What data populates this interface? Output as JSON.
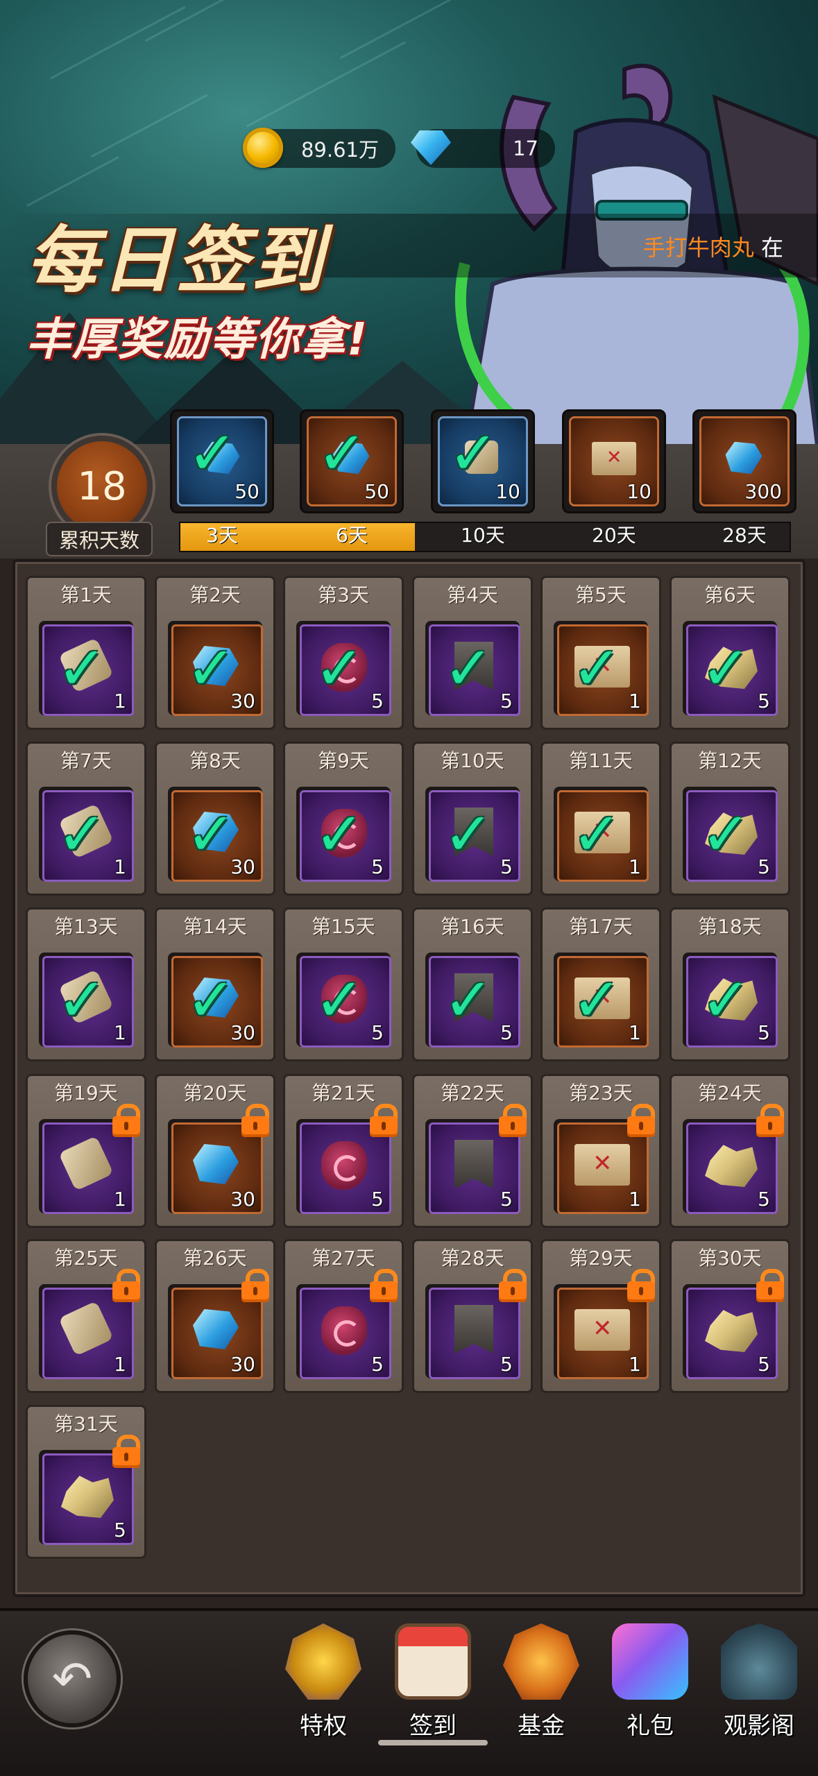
{
  "resources": {
    "coins": "89.61万",
    "gems": "17"
  },
  "notice": {
    "player_name": "手打牛肉丸",
    "suffix": "在"
  },
  "title": {
    "main": "每日签到",
    "subtitle": "丰厚奖励等你拿!"
  },
  "cumulative": {
    "days": "18",
    "label": "累积天数",
    "progress_fraction": 0.385,
    "milestones": [
      {
        "days_label": "3天",
        "qty": "50",
        "reward": "gem-icon",
        "frame": "blue",
        "claimed": true
      },
      {
        "days_label": "6天",
        "qty": "50",
        "reward": "gem-icon",
        "frame": "orange",
        "claimed": true
      },
      {
        "days_label": "10天",
        "qty": "10",
        "reward": "bag-icon",
        "frame": "blue",
        "claimed": true
      },
      {
        "days_label": "20天",
        "qty": "10",
        "reward": "map-icon",
        "frame": "orange",
        "claimed": false
      },
      {
        "days_label": "28天",
        "qty": "300",
        "reward": "gem-icon",
        "frame": "orange",
        "claimed": false
      }
    ]
  },
  "calendar": {
    "days": [
      {
        "label": "第1天",
        "item": "scroll",
        "qty": "1",
        "state": "claimed"
      },
      {
        "label": "第2天",
        "item": "gem",
        "qty": "30",
        "state": "claimed"
      },
      {
        "label": "第3天",
        "item": "rune",
        "qty": "5",
        "state": "claimed"
      },
      {
        "label": "第4天",
        "item": "banner",
        "qty": "5",
        "state": "claimed"
      },
      {
        "label": "第5天",
        "item": "map",
        "qty": "1",
        "state": "claimed"
      },
      {
        "label": "第6天",
        "item": "ore",
        "qty": "5",
        "state": "claimed"
      },
      {
        "label": "第7天",
        "item": "scroll",
        "qty": "1",
        "state": "claimed"
      },
      {
        "label": "第8天",
        "item": "gem",
        "qty": "30",
        "state": "claimed"
      },
      {
        "label": "第9天",
        "item": "rune",
        "qty": "5",
        "state": "claimed"
      },
      {
        "label": "第10天",
        "item": "banner",
        "qty": "5",
        "state": "claimed"
      },
      {
        "label": "第11天",
        "item": "map",
        "qty": "1",
        "state": "claimed"
      },
      {
        "label": "第12天",
        "item": "ore",
        "qty": "5",
        "state": "claimed"
      },
      {
        "label": "第13天",
        "item": "scroll",
        "qty": "1",
        "state": "claimed"
      },
      {
        "label": "第14天",
        "item": "gem",
        "qty": "30",
        "state": "claimed"
      },
      {
        "label": "第15天",
        "item": "rune",
        "qty": "5",
        "state": "claimed"
      },
      {
        "label": "第16天",
        "item": "banner",
        "qty": "5",
        "state": "claimed"
      },
      {
        "label": "第17天",
        "item": "map",
        "qty": "1",
        "state": "claimed"
      },
      {
        "label": "第18天",
        "item": "ore",
        "qty": "5",
        "state": "claimed"
      },
      {
        "label": "第19天",
        "item": "scroll",
        "qty": "1",
        "state": "locked"
      },
      {
        "label": "第20天",
        "item": "gem",
        "qty": "30",
        "state": "locked"
      },
      {
        "label": "第21天",
        "item": "rune",
        "qty": "5",
        "state": "locked"
      },
      {
        "label": "第22天",
        "item": "banner",
        "qty": "5",
        "state": "locked"
      },
      {
        "label": "第23天",
        "item": "map",
        "qty": "1",
        "state": "locked"
      },
      {
        "label": "第24天",
        "item": "ore",
        "qty": "5",
        "state": "locked"
      },
      {
        "label": "第25天",
        "item": "scroll",
        "qty": "1",
        "state": "locked"
      },
      {
        "label": "第26天",
        "item": "gem",
        "qty": "30",
        "state": "locked"
      },
      {
        "label": "第27天",
        "item": "rune",
        "qty": "5",
        "state": "locked"
      },
      {
        "label": "第28天",
        "item": "banner",
        "qty": "5",
        "state": "locked"
      },
      {
        "label": "第29天",
        "item": "map",
        "qty": "1",
        "state": "locked"
      },
      {
        "label": "第30天",
        "item": "ore",
        "qty": "5",
        "state": "locked"
      },
      {
        "label": "第31天",
        "item": "ore",
        "qty": "5",
        "state": "locked"
      }
    ]
  },
  "nav": {
    "items": [
      {
        "label": "特权",
        "icon": "privilege-icon",
        "active": false
      },
      {
        "label": "签到",
        "icon": "calendar-icon",
        "active": true
      },
      {
        "label": "基金",
        "icon": "fund-icon",
        "active": false
      },
      {
        "label": "礼包",
        "icon": "gift-icon",
        "active": false
      },
      {
        "label": "观影阁",
        "icon": "theater-icon",
        "active": false
      }
    ]
  },
  "colors": {
    "accent_orange": "#ff8a1c",
    "progress_fill": "#f7b52d",
    "check_green": "#22e49a",
    "frame_purple": "#3f1b62",
    "frame_orange": "#5e2a10",
    "frame_blue": "#163b62"
  }
}
